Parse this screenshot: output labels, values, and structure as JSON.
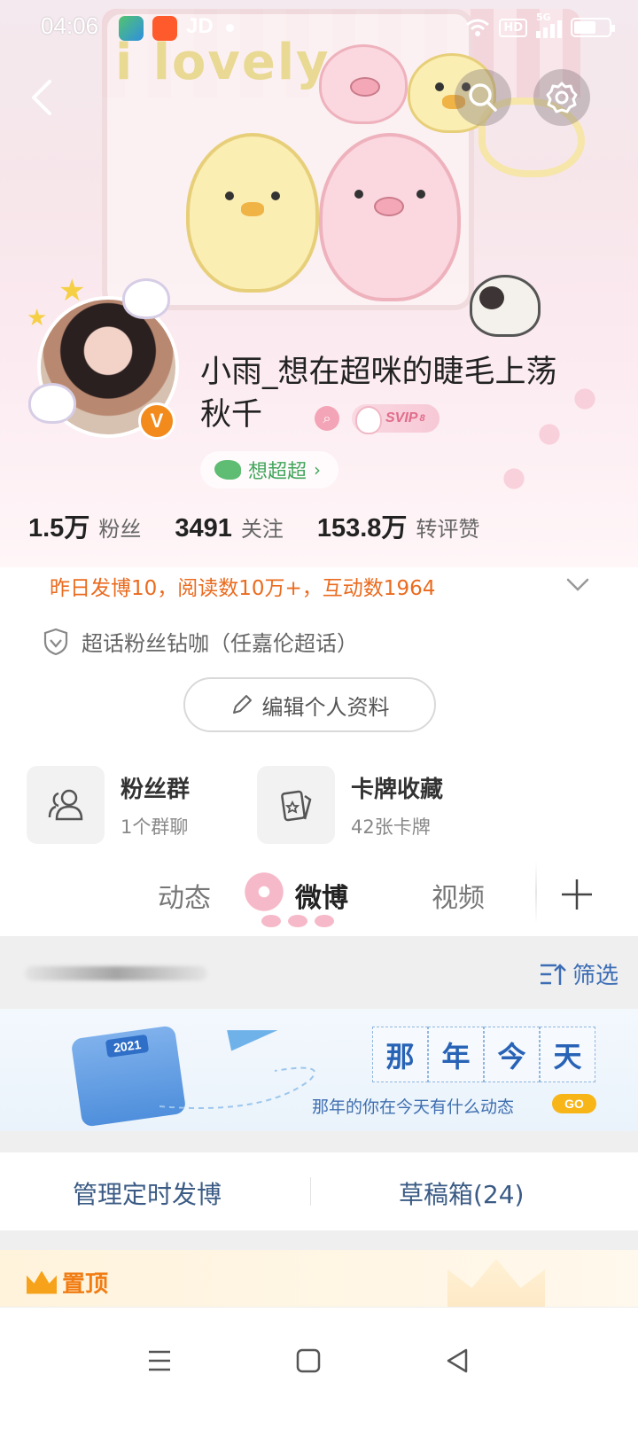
{
  "status_bar": {
    "time": "04:06",
    "app_icons": [
      "news-app-icon",
      "kuaishou-app-icon"
    ],
    "carrier_label": "JD",
    "hd_label": "HD",
    "network_label": "5G"
  },
  "header": {
    "banner_text": "i lovely",
    "back_icon": "chevron-left-icon",
    "search_icon": "search-icon",
    "settings_icon": "gear-icon"
  },
  "profile": {
    "username": "小雨_想在超咪的睫毛上荡秋千",
    "verified_badge": "V",
    "svip_label": "SVIP",
    "svip_level": "8",
    "super_topic_label": "想超超",
    "super_topic_chevron": "›",
    "stats": [
      {
        "value": "1.5万",
        "label": "粉丝"
      },
      {
        "value": "3491",
        "label": "关注"
      },
      {
        "value": "153.8万",
        "label": "转评赞"
      }
    ],
    "summary": "昨日发博10，阅读数10万+，互动数1964",
    "fan_line": "超话粉丝钻咖（任嘉伦超话）",
    "edit_button": "编辑个人资料"
  },
  "cards": [
    {
      "title": "粉丝群",
      "subtitle": "1个群聊",
      "icon": "users-icon"
    },
    {
      "title": "卡牌收藏",
      "subtitle": "42张卡牌",
      "icon": "card-icon"
    }
  ],
  "tabs": {
    "items": [
      "动态",
      "微博",
      "视频"
    ],
    "active": "微博"
  },
  "filter": {
    "label": "筛选"
  },
  "memory": {
    "year": "2021",
    "title_chars": [
      "那",
      "年",
      "今",
      "天"
    ],
    "subtitle": "那年的你在今天有什么动态",
    "go_label": "GO"
  },
  "manage": {
    "scheduled": "管理定时发博",
    "drafts": "草稿箱(24)"
  },
  "pinned": {
    "label": "置顶"
  },
  "colors": {
    "accent_orange": "#ea6b1f",
    "link_blue": "#3c6db5",
    "super_green": "#43a65c",
    "verify_orange": "#f28a1c"
  }
}
